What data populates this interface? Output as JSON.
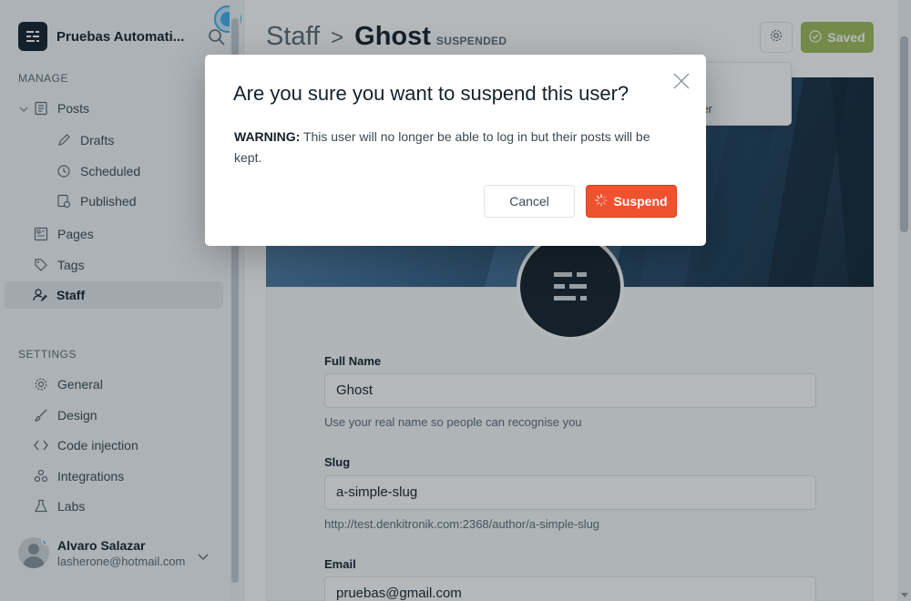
{
  "sidebar": {
    "site_title": "Pruebas Automati...",
    "manage_heading": "MANAGE",
    "settings_heading": "SETTINGS",
    "posts": "Posts",
    "drafts": "Drafts",
    "scheduled": "Scheduled",
    "published": "Published",
    "pages": "Pages",
    "tags": "Tags",
    "staff": "Staff",
    "general": "General",
    "design": "Design",
    "code_injection": "Code injection",
    "integrations": "Integrations",
    "labs": "Labs",
    "user_name": "Alvaro Salazar",
    "user_email": "lasherone@hotmail.com"
  },
  "header": {
    "crumb_parent": "Staff",
    "crumb_separator": ">",
    "crumb_current": "Ghost",
    "status_badge": "SUSPENDED",
    "saved_label": "Saved"
  },
  "dropdown_fragment": "er",
  "form": {
    "full_name_label": "Full Name",
    "full_name_value": "Ghost",
    "full_name_help": "Use your real name so people can recognise you",
    "slug_label": "Slug",
    "slug_value": "a-simple-slug",
    "slug_help": "http://test.denkitronik.com:2368/author/a-simple-slug",
    "email_label": "Email",
    "email_value": "pruebas@gmail.com"
  },
  "modal": {
    "title": "Are you sure you want to suspend this user?",
    "warning_label": "WARNING:",
    "warning_text": " This user will no longer be able to log in but their posts will be kept.",
    "cancel_label": "Cancel",
    "suspend_label": "Suspend"
  },
  "colors": {
    "accent": "#3eb0ef",
    "saved_green": "#9fbb58",
    "danger_red": "#f05230",
    "sidebar_bg": "#f5f7f8",
    "text_dark": "#15212a"
  },
  "icons": [
    "search-icon",
    "posts-icon",
    "pencil-icon",
    "clock-icon",
    "published-icon",
    "pages-icon",
    "tag-icon",
    "staff-icon",
    "gear-icon",
    "brush-icon",
    "code-icon",
    "integrations-icon",
    "labs-icon",
    "chevron-down-icon",
    "check-circle-icon",
    "close-icon",
    "spinner-icon"
  ]
}
